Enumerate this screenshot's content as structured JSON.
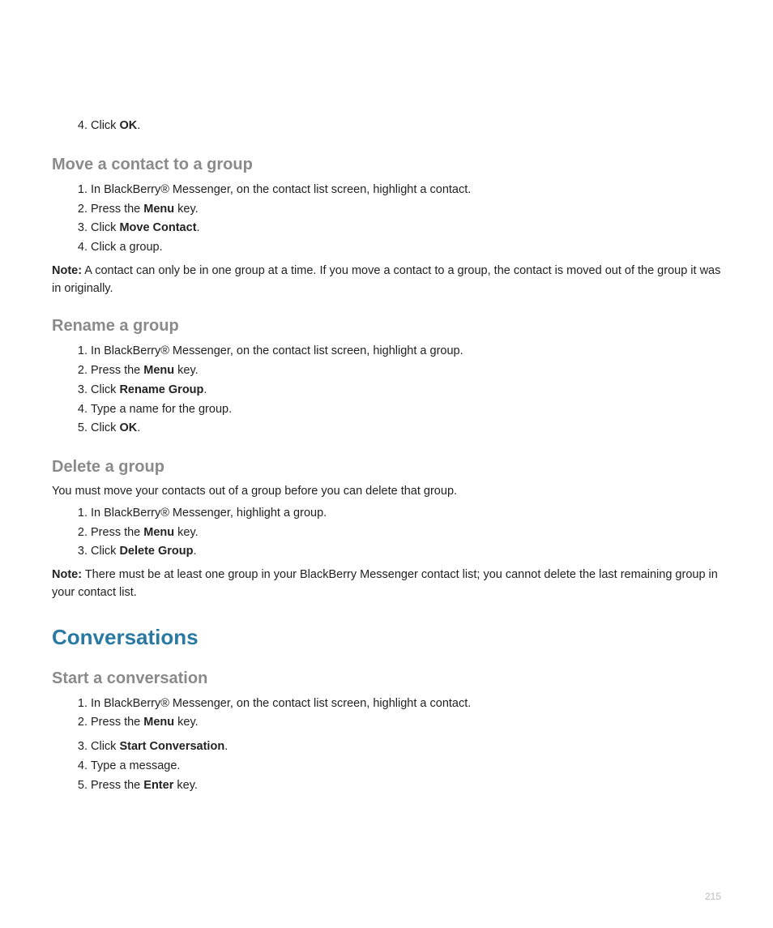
{
  "section_prev": {
    "step4": {
      "prefix": "Click ",
      "bold": "OK",
      "suffix": "."
    }
  },
  "move_contact": {
    "heading": "Move a contact to a group",
    "steps": {
      "s1": "In BlackBerry® Messenger, on the contact list screen, highlight a contact.",
      "s2": {
        "prefix": "Press the ",
        "bold": "Menu",
        "suffix": " key."
      },
      "s3": {
        "prefix": "Click ",
        "bold": "Move Contact",
        "suffix": "."
      },
      "s4": "Click a group."
    },
    "note_label": "Note:",
    "note_body": "  A contact can only be in one group at a time. If you move a contact to a group, the contact is moved out of the group it was in originally."
  },
  "rename_group": {
    "heading": "Rename a group",
    "steps": {
      "s1": "In BlackBerry® Messenger, on the contact list screen, highlight a group.",
      "s2": {
        "prefix": "Press the ",
        "bold": "Menu",
        "suffix": " key."
      },
      "s3": {
        "prefix": "Click ",
        "bold": "Rename Group",
        "suffix": "."
      },
      "s4": "Type a name for the group.",
      "s5": {
        "prefix": "Click ",
        "bold": "OK",
        "suffix": "."
      }
    }
  },
  "delete_group": {
    "heading": "Delete a group",
    "intro": "You must move your contacts out of a group before you can delete that group.",
    "steps": {
      "s1": "In BlackBerry® Messenger, highlight a group.",
      "s2": {
        "prefix": "Press the ",
        "bold": "Menu",
        "suffix": " key."
      },
      "s3": {
        "prefix": "Click ",
        "bold": "Delete Group",
        "suffix": "."
      }
    },
    "note_label": "Note:",
    "note_body": "  There must be at least one group in your BlackBerry Messenger contact list; you cannot delete the last remaining group in your contact list."
  },
  "conversations": {
    "heading": "Conversations"
  },
  "start_conv": {
    "heading": "Start a conversation",
    "steps": {
      "s1": "In BlackBerry® Messenger, on the contact list screen, highlight a contact.",
      "s2": {
        "prefix": "Press the ",
        "bold": "Menu",
        "suffix": " key."
      },
      "s3": {
        "prefix": "Click ",
        "bold": "Start Conversation",
        "suffix": "."
      },
      "s4": "Type a message.",
      "s5": {
        "prefix": "Press the ",
        "bold": "Enter",
        "suffix": " key."
      }
    }
  },
  "page_number": "215"
}
